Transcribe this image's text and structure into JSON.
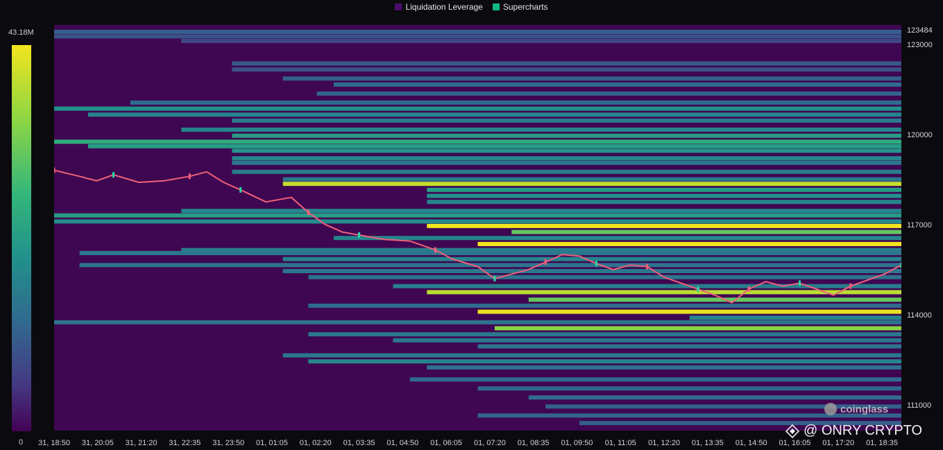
{
  "legend": {
    "items": [
      {
        "label": "Liquidation Leverage",
        "color": "#4b0c6b"
      },
      {
        "label": "Supercharts",
        "color": "#10b981"
      }
    ]
  },
  "colorbar": {
    "max_label": "43.18M",
    "min_label": "0"
  },
  "watermark": {
    "brand": "coinglass",
    "signature": "@ ONRY CRYPTO"
  },
  "chart_data": {
    "type": "heatmap",
    "title": "",
    "ylim": [
      110200,
      123680
    ],
    "y_ticks": [
      "123484",
      "123000",
      "120000",
      "117000",
      "114000",
      "111000"
    ],
    "x_ticks": [
      "31, 18:50",
      "31, 20:05",
      "31, 21:20",
      "31, 22:35",
      "31, 23:50",
      "01, 01:05",
      "01, 02:20",
      "01, 03:35",
      "01, 04:50",
      "01, 06:05",
      "01, 07:20",
      "01, 08:35",
      "01, 09:50",
      "01, 11:05",
      "01, 12:20",
      "01, 13:35",
      "01, 14:50",
      "01, 16:05",
      "01, 17:20",
      "01, 18:35"
    ],
    "colorscale": [
      "#440154",
      "#443983",
      "#31688e",
      "#21918c",
      "#35b779",
      "#93d741",
      "#f2e51d"
    ],
    "liquidation_bands": [
      {
        "price": 123450,
        "start": 0.0,
        "intensity": 0.3
      },
      {
        "price": 123300,
        "start": 0.0,
        "intensity": 0.25
      },
      {
        "price": 123150,
        "start": 0.15,
        "intensity": 0.22
      },
      {
        "price": 122400,
        "start": 0.21,
        "intensity": 0.28
      },
      {
        "price": 122200,
        "start": 0.21,
        "intensity": 0.25
      },
      {
        "price": 121900,
        "start": 0.27,
        "intensity": 0.3
      },
      {
        "price": 121700,
        "start": 0.33,
        "intensity": 0.35
      },
      {
        "price": 121400,
        "start": 0.31,
        "intensity": 0.32
      },
      {
        "price": 121100,
        "start": 0.09,
        "intensity": 0.35
      },
      {
        "price": 120900,
        "start": 0.0,
        "intensity": 0.5
      },
      {
        "price": 120700,
        "start": 0.04,
        "intensity": 0.45
      },
      {
        "price": 120500,
        "start": 0.21,
        "intensity": 0.4
      },
      {
        "price": 120200,
        "start": 0.15,
        "intensity": 0.45
      },
      {
        "price": 120000,
        "start": 0.21,
        "intensity": 0.55
      },
      {
        "price": 119800,
        "start": 0.0,
        "intensity": 0.62
      },
      {
        "price": 119650,
        "start": 0.04,
        "intensity": 0.55
      },
      {
        "price": 119500,
        "start": 0.21,
        "intensity": 0.52
      },
      {
        "price": 119250,
        "start": 0.21,
        "intensity": 0.45
      },
      {
        "price": 119100,
        "start": 0.21,
        "intensity": 0.4
      },
      {
        "price": 118800,
        "start": 0.21,
        "intensity": 0.42
      },
      {
        "price": 118550,
        "start": 0.27,
        "intensity": 0.4
      },
      {
        "price": 118400,
        "start": 0.27,
        "intensity": 0.92
      },
      {
        "price": 118200,
        "start": 0.44,
        "intensity": 0.55
      },
      {
        "price": 118000,
        "start": 0.44,
        "intensity": 0.5
      },
      {
        "price": 117800,
        "start": 0.44,
        "intensity": 0.45
      },
      {
        "price": 117500,
        "start": 0.15,
        "intensity": 0.45
      },
      {
        "price": 117350,
        "start": 0.0,
        "intensity": 0.55
      },
      {
        "price": 117150,
        "start": 0.0,
        "intensity": 0.48
      },
      {
        "price": 117000,
        "start": 0.44,
        "intensity": 1.0
      },
      {
        "price": 116800,
        "start": 0.54,
        "intensity": 0.75
      },
      {
        "price": 116600,
        "start": 0.33,
        "intensity": 0.45
      },
      {
        "price": 116400,
        "start": 0.5,
        "intensity": 1.0
      },
      {
        "price": 116200,
        "start": 0.15,
        "intensity": 0.42
      },
      {
        "price": 116100,
        "start": 0.03,
        "intensity": 0.4
      },
      {
        "price": 115900,
        "start": 0.27,
        "intensity": 0.45
      },
      {
        "price": 115700,
        "start": 0.03,
        "intensity": 0.38
      },
      {
        "price": 115500,
        "start": 0.27,
        "intensity": 0.4
      },
      {
        "price": 115300,
        "start": 0.3,
        "intensity": 0.38
      },
      {
        "price": 115000,
        "start": 0.4,
        "intensity": 0.42
      },
      {
        "price": 114800,
        "start": 0.44,
        "intensity": 0.9
      },
      {
        "price": 114550,
        "start": 0.56,
        "intensity": 0.75
      },
      {
        "price": 114350,
        "start": 0.3,
        "intensity": 0.35
      },
      {
        "price": 114150,
        "start": 0.5,
        "intensity": 0.98
      },
      {
        "price": 113950,
        "start": 0.75,
        "intensity": 0.45
      },
      {
        "price": 113800,
        "start": 0.0,
        "intensity": 0.38
      },
      {
        "price": 113600,
        "start": 0.52,
        "intensity": 0.82
      },
      {
        "price": 113400,
        "start": 0.3,
        "intensity": 0.4
      },
      {
        "price": 113200,
        "start": 0.4,
        "intensity": 0.4
      },
      {
        "price": 113000,
        "start": 0.5,
        "intensity": 0.38
      },
      {
        "price": 112700,
        "start": 0.27,
        "intensity": 0.4
      },
      {
        "price": 112500,
        "start": 0.3,
        "intensity": 0.45
      },
      {
        "price": 112300,
        "start": 0.44,
        "intensity": 0.38
      },
      {
        "price": 111900,
        "start": 0.42,
        "intensity": 0.35
      },
      {
        "price": 111600,
        "start": 0.5,
        "intensity": 0.33
      },
      {
        "price": 111300,
        "start": 0.56,
        "intensity": 0.35
      },
      {
        "price": 111000,
        "start": 0.58,
        "intensity": 0.3
      },
      {
        "price": 110700,
        "start": 0.5,
        "intensity": 0.32
      },
      {
        "price": 110450,
        "start": 0.62,
        "intensity": 0.3
      }
    ],
    "price_line": {
      "x": [
        0.0,
        0.03,
        0.05,
        0.07,
        0.1,
        0.13,
        0.16,
        0.18,
        0.2,
        0.22,
        0.25,
        0.28,
        0.3,
        0.32,
        0.34,
        0.36,
        0.39,
        0.42,
        0.45,
        0.47,
        0.5,
        0.52,
        0.54,
        0.56,
        0.58,
        0.6,
        0.62,
        0.64,
        0.66,
        0.68,
        0.7,
        0.72,
        0.74,
        0.76,
        0.78,
        0.8,
        0.82,
        0.84,
        0.86,
        0.88,
        0.9,
        0.92,
        0.94,
        0.96,
        0.98,
        1.0
      ],
      "y": [
        118850,
        118650,
        118500,
        118700,
        118450,
        118500,
        118650,
        118800,
        118450,
        118200,
        117800,
        117950,
        117450,
        117050,
        116800,
        116700,
        116550,
        116500,
        116200,
        115900,
        115650,
        115250,
        115400,
        115550,
        115800,
        116050,
        116000,
        115750,
        115550,
        115700,
        115650,
        115300,
        115100,
        114900,
        114700,
        114450,
        114900,
        115150,
        115000,
        115100,
        114900,
        114700,
        115000,
        115200,
        115400,
        115700
      ]
    }
  }
}
